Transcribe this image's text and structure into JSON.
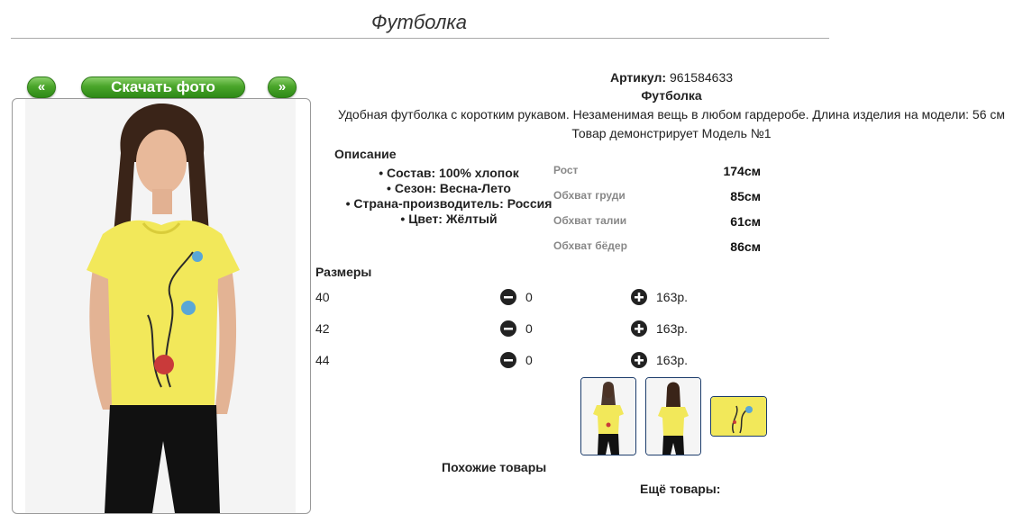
{
  "page": {
    "title": "Футболка"
  },
  "gallery": {
    "prev_label": "«",
    "download_label": "Скачать фото",
    "next_label": "»"
  },
  "product": {
    "article_label": "Артикул:",
    "article_value": "961584633",
    "name": "Футболка",
    "description": "Удобная футболка с коротким рукавом. Незаменимая вещь в любом гардеробе. Длина изделия на модели: 56 см",
    "model_note": "Товар демонстрирует Модель №1"
  },
  "details": {
    "heading": "Описание",
    "items": [
      "Состав: 100% хлопок",
      "Сезон: Весна-Лето",
      "Страна-производитель: Россия",
      "Цвет: Жёлтый"
    ]
  },
  "measurements": [
    {
      "label": "Рост",
      "value": "174см"
    },
    {
      "label": "Обхват груди",
      "value": "85см"
    },
    {
      "label": "Обхват талии",
      "value": "61см"
    },
    {
      "label": "Обхват бёдер",
      "value": "86см"
    }
  ],
  "sizes": {
    "heading": "Размеры",
    "rows": [
      {
        "size": "40",
        "qty": "0",
        "price": "163р."
      },
      {
        "size": "42",
        "qty": "0",
        "price": "163р."
      },
      {
        "size": "44",
        "qty": "0",
        "price": "163р."
      }
    ]
  },
  "sections": {
    "similar": "Похожие товары",
    "more": "Ещё товары:"
  },
  "colors": {
    "shirt": "#f2e85a",
    "button_green": "#4aa52a",
    "thumb_border": "#1c3c6b"
  }
}
